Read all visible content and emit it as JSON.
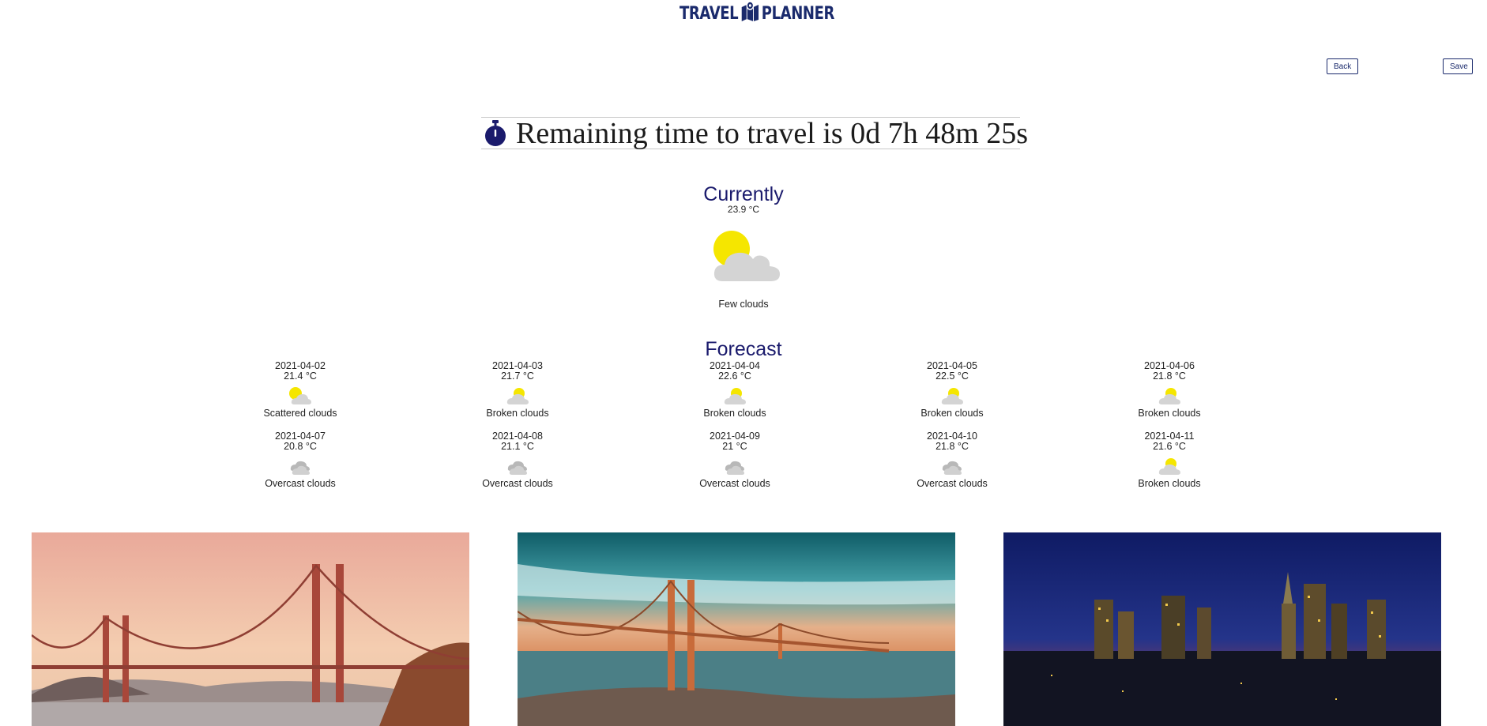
{
  "header": {
    "logo_left": "TRAVEL",
    "logo_right": "PLANNER",
    "back_label": "Back",
    "save_label": "Save"
  },
  "countdown": {
    "text": "Remaining time to travel is 0d 7h 48m 25s",
    "icon": "stopwatch-icon"
  },
  "current": {
    "title": "Currently",
    "temp": "23.9 °C",
    "description": "Few clouds",
    "icon": "few-clouds-icon"
  },
  "forecast": {
    "title": "Forecast",
    "days": [
      {
        "date": "2021-04-02",
        "temp": "21.4 °C",
        "desc": "Scattered clouds",
        "icon": "scattered-clouds-icon"
      },
      {
        "date": "2021-04-03",
        "temp": "21.7 °C",
        "desc": "Broken clouds",
        "icon": "broken-clouds-icon"
      },
      {
        "date": "2021-04-04",
        "temp": "22.6 °C",
        "desc": "Broken clouds",
        "icon": "broken-clouds-icon"
      },
      {
        "date": "2021-04-05",
        "temp": "22.5 °C",
        "desc": "Broken clouds",
        "icon": "broken-clouds-icon"
      },
      {
        "date": "2021-04-06",
        "temp": "21.8 °C",
        "desc": "Broken clouds",
        "icon": "broken-clouds-icon"
      },
      {
        "date": "2021-04-07",
        "temp": "20.8 °C",
        "desc": "Overcast clouds",
        "icon": "overcast-clouds-icon"
      },
      {
        "date": "2021-04-08",
        "temp": "21.1 °C",
        "desc": "Overcast clouds",
        "icon": "overcast-clouds-icon"
      },
      {
        "date": "2021-04-09",
        "temp": "21 °C",
        "desc": "Overcast clouds",
        "icon": "overcast-clouds-icon"
      },
      {
        "date": "2021-04-10",
        "temp": "21.8 °C",
        "desc": "Overcast clouds",
        "icon": "overcast-clouds-icon"
      },
      {
        "date": "2021-04-11",
        "temp": "21.6 °C",
        "desc": "Broken clouds",
        "icon": "broken-clouds-icon"
      }
    ]
  },
  "photos": [
    {
      "icon": "golden-gate-sunset-photo"
    },
    {
      "icon": "golden-gate-teal-sky-photo"
    },
    {
      "icon": "city-skyline-night-photo"
    }
  ],
  "colors": {
    "brand_navy": "#1a2a6c",
    "sun_yellow": "#f5e600",
    "cloud_gray": "#d4d4d4"
  }
}
